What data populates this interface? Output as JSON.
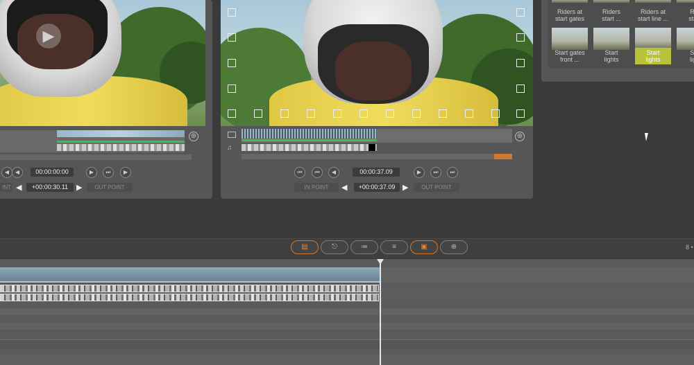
{
  "source_viewer": {
    "timecode": "00:00:00:00",
    "in_label": "IN POINT",
    "in_label_visible": "INT",
    "duration": "+00:00:30.11",
    "out_label": "OUT POINT"
  },
  "record_viewer": {
    "timecode": "00:00:37.09",
    "in_label": "IN POINT",
    "duration": "+00:00:37.09",
    "out_label": "OUT POINT"
  },
  "library": {
    "items": [
      {
        "label": "Riders at start gates",
        "l1": "Riders at",
        "l2": "start gates",
        "selected": false
      },
      {
        "label": "Riders start ...",
        "l1": "Riders",
        "l2": "start ...",
        "selected": false
      },
      {
        "label": "Riders at start line ...",
        "l1": "Riders at",
        "l2": "start line ...",
        "selected": false
      },
      {
        "label": "Riders start",
        "l1": "Rid",
        "l2": "start",
        "selected": false
      },
      {
        "label": "Start gates front ...",
        "l1": "Start gates",
        "l2": "front ...",
        "selected": false
      },
      {
        "label": "Start lights",
        "l1": "Start",
        "l2": "lights",
        "selected": false
      },
      {
        "label": "Start lights",
        "l1": "Start",
        "l2": "lights",
        "selected": true
      },
      {
        "label": "Start lights",
        "l1": "Sta",
        "l2": "ligh",
        "selected": false
      }
    ]
  },
  "timeline_toolbar": {
    "tools": [
      "storyboard-view",
      "trim-in",
      "trim-out",
      "trim-both",
      "lock",
      "zoom"
    ],
    "right_label": "8 •"
  },
  "icons": {
    "play": "▶",
    "prev": "◀",
    "next": "▶",
    "to_start": "⏮",
    "to_end": "⏭",
    "left_arrow": "◀",
    "right_arrow": "▶",
    "lock": "▣",
    "zoom": "⊕"
  },
  "colors": {
    "accent_orange": "#d2782f",
    "selected_thumb_label": "#b8c23a",
    "audio_green": "#39c24a"
  }
}
